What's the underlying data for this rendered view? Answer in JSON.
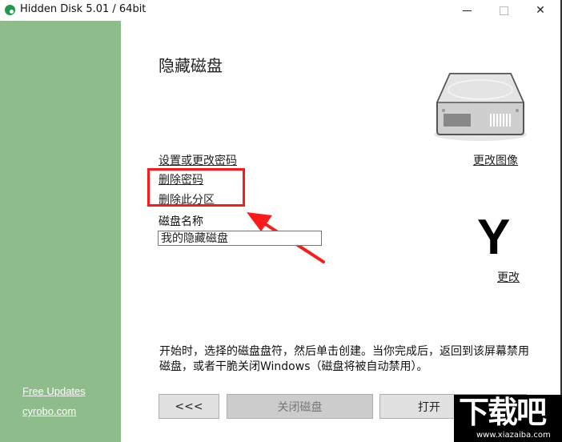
{
  "window": {
    "title": "Hidden Disk 5.01 / 64bit",
    "controls": {
      "minimize": "minimize",
      "maximize": "maximize",
      "close": "close"
    }
  },
  "sidebar": {
    "color": "#8fbc8b",
    "links": [
      {
        "label": "Free Updates"
      },
      {
        "label": "cyrobo.com"
      }
    ]
  },
  "main": {
    "heading": "隐藏磁盘",
    "change_image_link": "更改图像",
    "links": [
      {
        "label": "设置或更改密码"
      },
      {
        "label": "删除密码"
      },
      {
        "label": "删除此分区"
      }
    ],
    "disk_name_label": "磁盘名称",
    "disk_name_value": "我的隐藏磁盘",
    "drive_letter": "Y",
    "change_letter_link": "更改",
    "info_text": "开始时，选择的磁盘盘符，然后单击创建。当你完成后，返回到该屏幕禁用磁盘，或者干脆关闭Windows（磁盘将被自动禁用）。"
  },
  "buttons": {
    "back": "<<<",
    "close_disk": "关闭磁盘",
    "open": "打开"
  },
  "annotation": {
    "highlight_color": "#ff1a1a"
  },
  "watermark": {
    "big": "下载吧",
    "small": "www.xiazaiba.com"
  }
}
